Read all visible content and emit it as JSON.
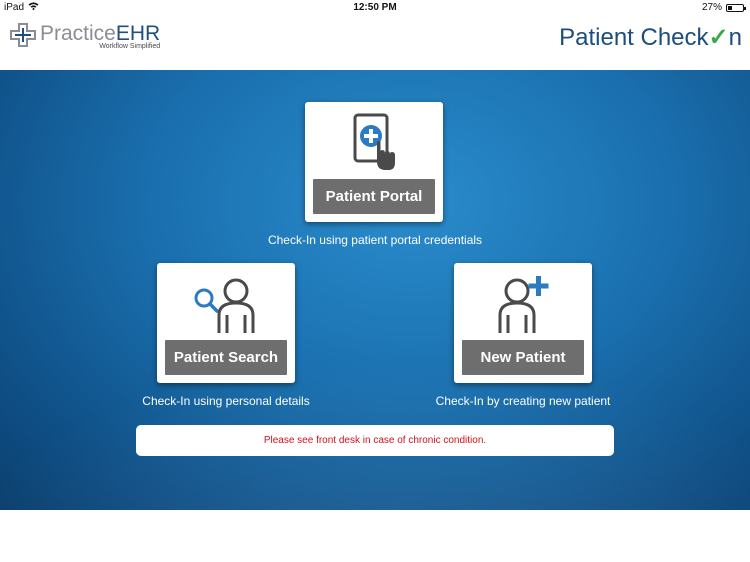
{
  "status_bar": {
    "device": "iPad",
    "time": "12:50 PM",
    "battery": "27%",
    "battery_level": 0.27
  },
  "header": {
    "logo": {
      "main_a": "Practice",
      "main_b": "EHR",
      "tagline": "Workflow Simplified"
    },
    "app_title": "Patient Check",
    "app_title_mark": "✓",
    "app_title_end": "n"
  },
  "options": {
    "portal": {
      "label": "Patient Portal",
      "caption": "Check-In using patient portal credentials",
      "icon": "tablet-plus-icon"
    },
    "search": {
      "label": "Patient Search",
      "caption": "Check-In using personal details",
      "icon": "person-search-icon"
    },
    "new_patient": {
      "label": "New Patient",
      "caption": "Check-In by creating new patient",
      "icon": "person-add-icon"
    }
  },
  "notice": "Please see front desk in case of chronic condition.",
  "colors": {
    "header_blue": "#1b4e7c",
    "accent_green": "#3aa84a",
    "button_gray": "#6e6e6e",
    "notice_red": "#d0121b",
    "icon_blue": "#2b7bc2"
  }
}
